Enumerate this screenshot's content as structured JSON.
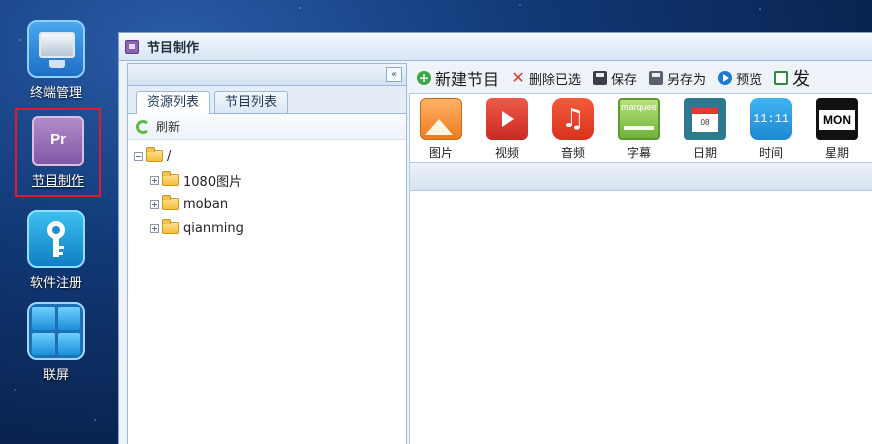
{
  "desktop": {
    "items": [
      {
        "id": "terminal",
        "label": "终端管理"
      },
      {
        "id": "program",
        "label": "节目制作",
        "icon_text": "Pr"
      },
      {
        "id": "register",
        "label": "软件注册"
      },
      {
        "id": "screen",
        "label": "联屏"
      }
    ]
  },
  "window": {
    "title": "节目制作",
    "collapse_glyph": "«",
    "tabs": [
      {
        "label": "资源列表",
        "active": true
      },
      {
        "label": "节目列表",
        "active": false
      }
    ],
    "refresh_label": "刷新",
    "tree": {
      "root": "/",
      "children": [
        "1080图片",
        "moban",
        "qianming"
      ]
    },
    "toolbar": {
      "new": "新建节目",
      "delete": "删除已选",
      "save": "保存",
      "save_as": "另存为",
      "preview": "预览",
      "publish": "发"
    },
    "media": [
      {
        "label": "图片"
      },
      {
        "label": "视频"
      },
      {
        "label": "音频",
        "glyph": "♫"
      },
      {
        "label": "字幕",
        "icon_text": "marquee"
      },
      {
        "label": "日期",
        "icon_text": "08"
      },
      {
        "label": "时间",
        "icon_text": "11:11"
      },
      {
        "label": "星期",
        "icon_text": "MON"
      }
    ]
  },
  "colors": {
    "desktop_bg": "#123a78",
    "highlight_border": "#e8182b",
    "window_border": "#7fa3cf"
  }
}
